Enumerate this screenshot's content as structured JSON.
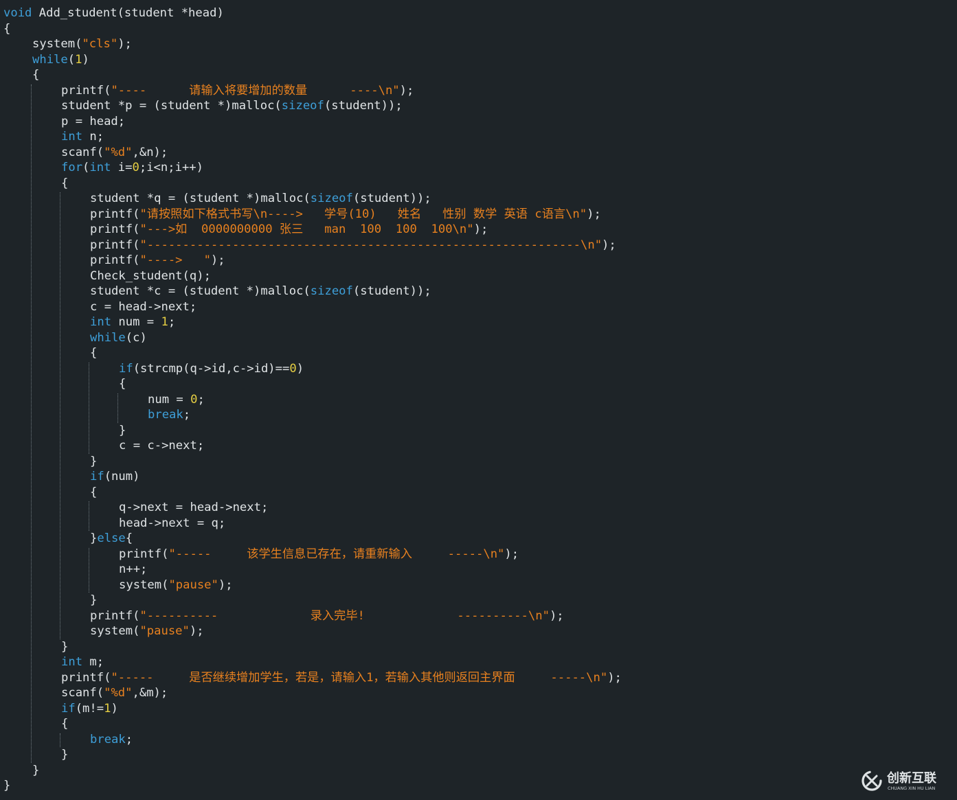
{
  "colors": {
    "background": "#1e2428",
    "plain_text": "#e0e4e6",
    "keyword": "#3e9fd9",
    "string": "#e8811f",
    "number": "#e6cf43",
    "indent_guide": "#6f7a80"
  },
  "code": {
    "lines": [
      {
        "indent": 0,
        "tokens": [
          {
            "t": "kw",
            "v": "void"
          },
          {
            "t": "pl",
            "v": " Add_student(student *head)"
          }
        ]
      },
      {
        "indent": 0,
        "tokens": [
          {
            "t": "pl",
            "v": "{"
          }
        ]
      },
      {
        "indent": 1,
        "tokens": [
          {
            "t": "pl",
            "v": "system("
          },
          {
            "t": "str",
            "v": "\"cls\""
          },
          {
            "t": "pl",
            "v": ");"
          }
        ]
      },
      {
        "indent": 1,
        "tokens": [
          {
            "t": "kw",
            "v": "while"
          },
          {
            "t": "pl",
            "v": "("
          },
          {
            "t": "num",
            "v": "1"
          },
          {
            "t": "pl",
            "v": ")"
          }
        ]
      },
      {
        "indent": 1,
        "tokens": [
          {
            "t": "pl",
            "v": "{"
          }
        ]
      },
      {
        "indent": 2,
        "tokens": [
          {
            "t": "pl",
            "v": "printf("
          },
          {
            "t": "str",
            "v": "\"----      请输入将要增加的数量      ----\\n\""
          },
          {
            "t": "pl",
            "v": ");"
          }
        ]
      },
      {
        "indent": 2,
        "tokens": [
          {
            "t": "pl",
            "v": "student *p = (student *)malloc("
          },
          {
            "t": "kw",
            "v": "sizeof"
          },
          {
            "t": "pl",
            "v": "(student));"
          }
        ]
      },
      {
        "indent": 2,
        "tokens": [
          {
            "t": "pl",
            "v": "p = head;"
          }
        ]
      },
      {
        "indent": 2,
        "tokens": [
          {
            "t": "kw",
            "v": "int"
          },
          {
            "t": "pl",
            "v": " n;"
          }
        ]
      },
      {
        "indent": 2,
        "tokens": [
          {
            "t": "pl",
            "v": "scanf("
          },
          {
            "t": "str",
            "v": "\"%d\""
          },
          {
            "t": "pl",
            "v": ",&n);"
          }
        ]
      },
      {
        "indent": 2,
        "tokens": [
          {
            "t": "kw",
            "v": "for"
          },
          {
            "t": "pl",
            "v": "("
          },
          {
            "t": "kw",
            "v": "int"
          },
          {
            "t": "pl",
            "v": " i="
          },
          {
            "t": "num",
            "v": "0"
          },
          {
            "t": "pl",
            "v": ";i<n;i++)"
          }
        ]
      },
      {
        "indent": 2,
        "tokens": [
          {
            "t": "pl",
            "v": "{"
          }
        ]
      },
      {
        "indent": 3,
        "tokens": [
          {
            "t": "pl",
            "v": "student *q = (student *)malloc("
          },
          {
            "t": "kw",
            "v": "sizeof"
          },
          {
            "t": "pl",
            "v": "(student));"
          }
        ]
      },
      {
        "indent": 3,
        "tokens": [
          {
            "t": "pl",
            "v": "printf("
          },
          {
            "t": "str",
            "v": "\"请按照如下格式书写\\n---->   学号(10)   姓名   性别 数学 英语 c语言\\n\""
          },
          {
            "t": "pl",
            "v": ");"
          }
        ]
      },
      {
        "indent": 3,
        "tokens": [
          {
            "t": "pl",
            "v": "printf("
          },
          {
            "t": "str",
            "v": "\"--->如  0000000000 张三   man  100  100  100\\n\""
          },
          {
            "t": "pl",
            "v": ");"
          }
        ]
      },
      {
        "indent": 3,
        "tokens": [
          {
            "t": "pl",
            "v": "printf("
          },
          {
            "t": "str",
            "v": "\"-------------------------------------------------------------\\n\""
          },
          {
            "t": "pl",
            "v": ");"
          }
        ]
      },
      {
        "indent": 3,
        "tokens": [
          {
            "t": "pl",
            "v": "printf("
          },
          {
            "t": "str",
            "v": "\"---->   \""
          },
          {
            "t": "pl",
            "v": ");"
          }
        ]
      },
      {
        "indent": 3,
        "tokens": [
          {
            "t": "pl",
            "v": "Check_student(q);"
          }
        ]
      },
      {
        "indent": 3,
        "tokens": [
          {
            "t": "pl",
            "v": "student *c = (student *)malloc("
          },
          {
            "t": "kw",
            "v": "sizeof"
          },
          {
            "t": "pl",
            "v": "(student));"
          }
        ]
      },
      {
        "indent": 3,
        "tokens": [
          {
            "t": "pl",
            "v": "c = head->next;"
          }
        ]
      },
      {
        "indent": 3,
        "tokens": [
          {
            "t": "kw",
            "v": "int"
          },
          {
            "t": "pl",
            "v": " num = "
          },
          {
            "t": "num",
            "v": "1"
          },
          {
            "t": "pl",
            "v": ";"
          }
        ]
      },
      {
        "indent": 3,
        "tokens": [
          {
            "t": "kw",
            "v": "while"
          },
          {
            "t": "pl",
            "v": "(c)"
          }
        ]
      },
      {
        "indent": 3,
        "tokens": [
          {
            "t": "pl",
            "v": "{"
          }
        ]
      },
      {
        "indent": 4,
        "tokens": [
          {
            "t": "kw",
            "v": "if"
          },
          {
            "t": "pl",
            "v": "(strcmp(q->id,c->id)=="
          },
          {
            "t": "num",
            "v": "0"
          },
          {
            "t": "pl",
            "v": ")"
          }
        ]
      },
      {
        "indent": 4,
        "tokens": [
          {
            "t": "pl",
            "v": "{"
          }
        ]
      },
      {
        "indent": 5,
        "tokens": [
          {
            "t": "pl",
            "v": "num = "
          },
          {
            "t": "num",
            "v": "0"
          },
          {
            "t": "pl",
            "v": ";"
          }
        ]
      },
      {
        "indent": 5,
        "tokens": [
          {
            "t": "kw",
            "v": "break"
          },
          {
            "t": "pl",
            "v": ";"
          }
        ]
      },
      {
        "indent": 4,
        "tokens": [
          {
            "t": "pl",
            "v": "}"
          }
        ]
      },
      {
        "indent": 4,
        "tokens": [
          {
            "t": "pl",
            "v": "c = c->next;"
          }
        ]
      },
      {
        "indent": 3,
        "tokens": [
          {
            "t": "pl",
            "v": "}"
          }
        ]
      },
      {
        "indent": 3,
        "tokens": [
          {
            "t": "kw",
            "v": "if"
          },
          {
            "t": "pl",
            "v": "(num)"
          }
        ]
      },
      {
        "indent": 3,
        "tokens": [
          {
            "t": "pl",
            "v": "{"
          }
        ]
      },
      {
        "indent": 4,
        "tokens": [
          {
            "t": "pl",
            "v": "q->next = head->next;"
          }
        ]
      },
      {
        "indent": 4,
        "tokens": [
          {
            "t": "pl",
            "v": "head->next = q;"
          }
        ]
      },
      {
        "indent": 3,
        "tokens": [
          {
            "t": "pl",
            "v": "}"
          },
          {
            "t": "kw",
            "v": "else"
          },
          {
            "t": "pl",
            "v": "{"
          }
        ]
      },
      {
        "indent": 4,
        "tokens": [
          {
            "t": "pl",
            "v": "printf("
          },
          {
            "t": "str",
            "v": "\"-----     该学生信息已存在，请重新输入     -----\\n\""
          },
          {
            "t": "pl",
            "v": ");"
          }
        ]
      },
      {
        "indent": 4,
        "tokens": [
          {
            "t": "pl",
            "v": "n++;"
          }
        ]
      },
      {
        "indent": 4,
        "tokens": [
          {
            "t": "pl",
            "v": "system("
          },
          {
            "t": "str",
            "v": "\"pause\""
          },
          {
            "t": "pl",
            "v": ");"
          }
        ]
      },
      {
        "indent": 3,
        "tokens": [
          {
            "t": "pl",
            "v": "}"
          }
        ]
      },
      {
        "indent": 3,
        "tokens": [
          {
            "t": "pl",
            "v": "printf("
          },
          {
            "t": "str",
            "v": "\"----------             录入完毕!             ----------\\n\""
          },
          {
            "t": "pl",
            "v": ");"
          }
        ]
      },
      {
        "indent": 3,
        "tokens": [
          {
            "t": "pl",
            "v": "system("
          },
          {
            "t": "str",
            "v": "\"pause\""
          },
          {
            "t": "pl",
            "v": ");"
          }
        ]
      },
      {
        "indent": 2,
        "tokens": [
          {
            "t": "pl",
            "v": "}"
          }
        ]
      },
      {
        "indent": 2,
        "tokens": [
          {
            "t": "kw",
            "v": "int"
          },
          {
            "t": "pl",
            "v": " m;"
          }
        ]
      },
      {
        "indent": 2,
        "tokens": [
          {
            "t": "pl",
            "v": "printf("
          },
          {
            "t": "str",
            "v": "\"-----     是否继续增加学生，若是，请输入1，若输入其他则返回主界面     -----\\n\""
          },
          {
            "t": "pl",
            "v": ");"
          }
        ]
      },
      {
        "indent": 2,
        "tokens": [
          {
            "t": "pl",
            "v": "scanf("
          },
          {
            "t": "str",
            "v": "\"%d\""
          },
          {
            "t": "pl",
            "v": ",&m);"
          }
        ]
      },
      {
        "indent": 2,
        "tokens": [
          {
            "t": "kw",
            "v": "if"
          },
          {
            "t": "pl",
            "v": "(m!="
          },
          {
            "t": "num",
            "v": "1"
          },
          {
            "t": "pl",
            "v": ")"
          }
        ]
      },
      {
        "indent": 2,
        "tokens": [
          {
            "t": "pl",
            "v": "{"
          }
        ]
      },
      {
        "indent": 3,
        "tokens": [
          {
            "t": "kw",
            "v": "break"
          },
          {
            "t": "pl",
            "v": ";"
          }
        ]
      },
      {
        "indent": 2,
        "tokens": [
          {
            "t": "pl",
            "v": "}"
          }
        ]
      },
      {
        "indent": 1,
        "tokens": [
          {
            "t": "pl",
            "v": "}"
          }
        ]
      },
      {
        "indent": 0,
        "tokens": [
          {
            "t": "pl",
            "v": "}"
          }
        ]
      }
    ],
    "indent_guides": [
      {
        "level": 1,
        "from_line": 5,
        "to_line": 48
      },
      {
        "level": 2,
        "from_line": 12,
        "to_line": 40
      },
      {
        "level": 3,
        "from_line": 23,
        "to_line": 28
      },
      {
        "level": 4,
        "from_line": 25,
        "to_line": 26
      },
      {
        "level": 3,
        "from_line": 32,
        "to_line": 33
      },
      {
        "level": 3,
        "from_line": 35,
        "to_line": 37
      },
      {
        "level": 2,
        "from_line": 47,
        "to_line": 47
      }
    ]
  },
  "watermark": {
    "brand_text": "创新互联",
    "brand_subtext": "CHUANG XIN HU LIAN",
    "icon": "brand-logo-icon"
  }
}
